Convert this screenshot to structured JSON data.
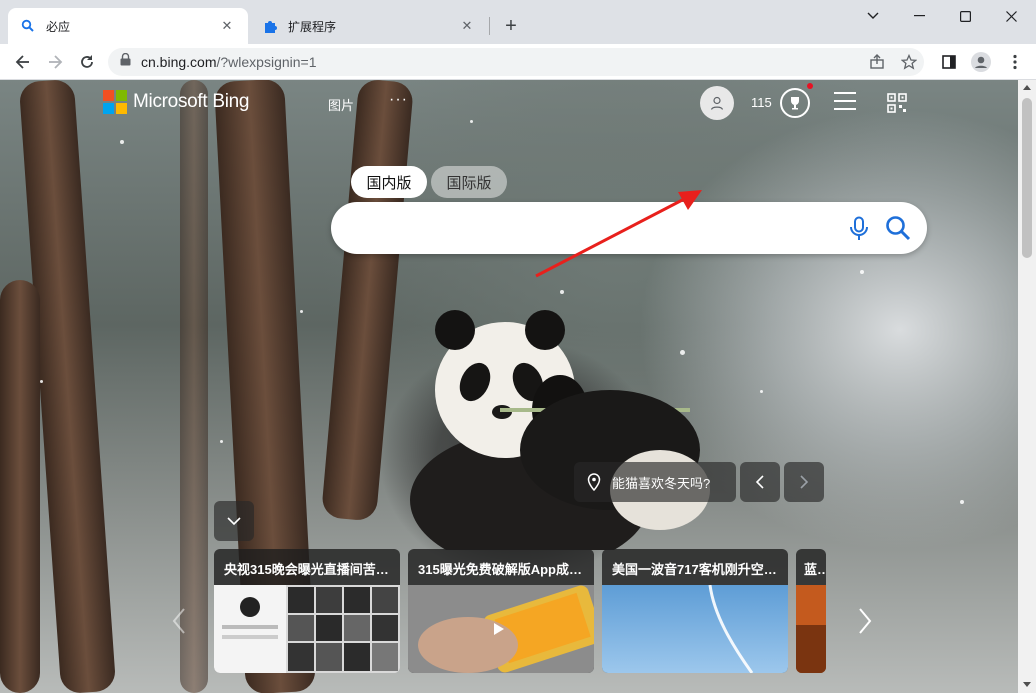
{
  "browser": {
    "tabs": [
      {
        "title": "必应",
        "icon": "search-icon",
        "active": true
      },
      {
        "title": "扩展程序",
        "icon": "puzzle-icon",
        "active": false
      }
    ],
    "url_host": "cn.bing.com",
    "url_path": "/?wlexpsignin=1"
  },
  "bing": {
    "brand": "Microsoft Bing",
    "nav_images": "图片",
    "nav_more": "···",
    "points": "115",
    "region_tabs": [
      "国内版",
      "国际版"
    ],
    "search_value": "",
    "image_location": "能猫喜欢冬天吗?",
    "news": [
      {
        "caption": "央视315晚会曝光直播间苦…"
      },
      {
        "caption": "315曝光免费破解版App成…"
      },
      {
        "caption": "美国一波音717客机刚升空…"
      },
      {
        "caption": "蓝鲸"
      }
    ]
  },
  "colors": {
    "ms_red": "#f25022",
    "ms_green": "#7fba00",
    "ms_blue": "#00a4ef",
    "ms_yellow": "#ffb900",
    "annotation_arrow": "#e8201c"
  }
}
